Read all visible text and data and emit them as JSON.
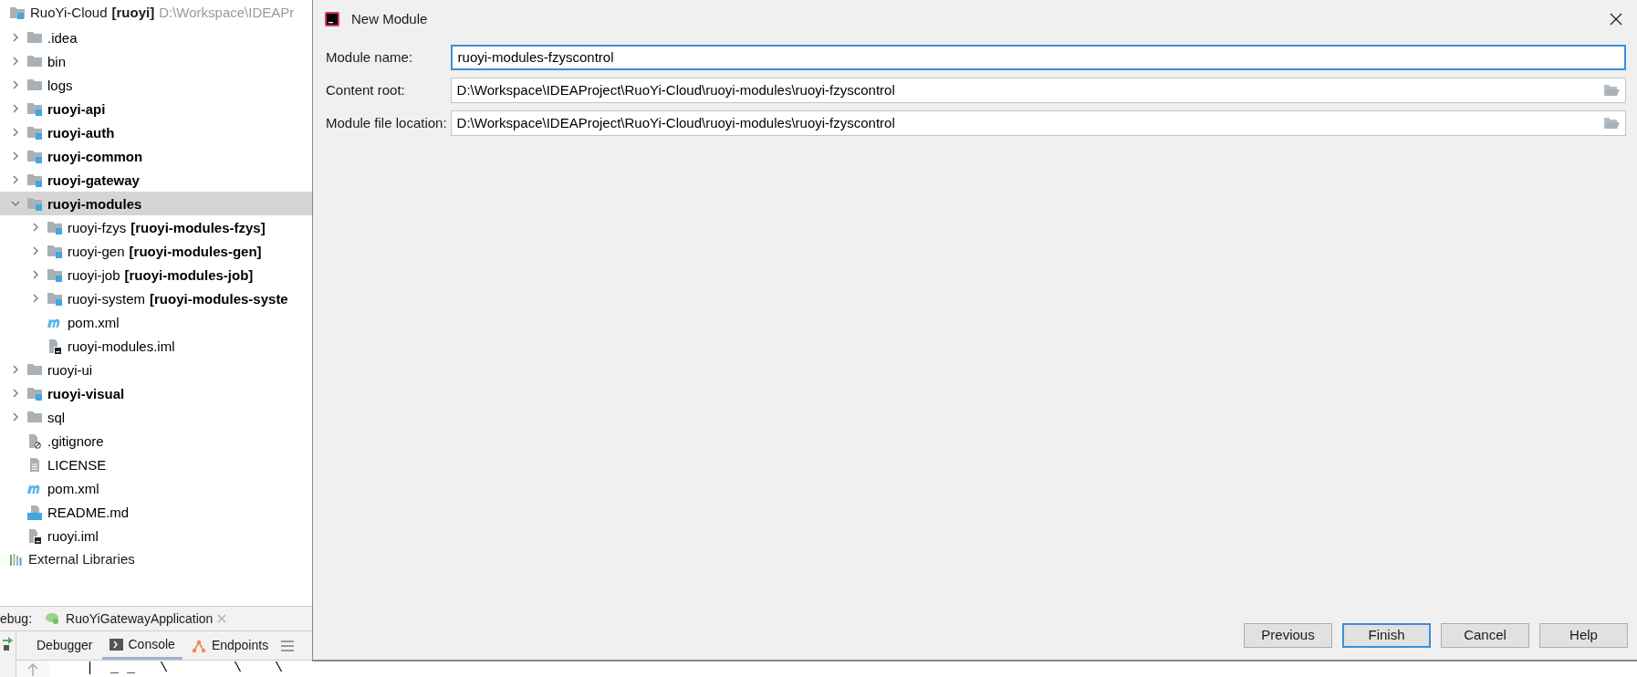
{
  "project_tree": {
    "root": {
      "name": "RuoYi-Cloud",
      "suffix": "[ruoyi]",
      "path": "D:\\Workspace\\IDEAPr"
    },
    "items": [
      {
        "name": ".idea",
        "kind": "folder",
        "bold": false,
        "expanded": false,
        "selected": false
      },
      {
        "name": "bin",
        "kind": "folder",
        "bold": false,
        "expanded": false,
        "selected": false
      },
      {
        "name": "logs",
        "kind": "folder",
        "bold": false,
        "expanded": false,
        "selected": false
      },
      {
        "name": "ruoyi-api",
        "kind": "module",
        "bold": true,
        "expanded": false,
        "selected": false
      },
      {
        "name": "ruoyi-auth",
        "kind": "module",
        "bold": true,
        "expanded": false,
        "selected": false
      },
      {
        "name": "ruoyi-common",
        "kind": "module",
        "bold": true,
        "expanded": false,
        "selected": false
      },
      {
        "name": "ruoyi-gateway",
        "kind": "module",
        "bold": true,
        "expanded": false,
        "selected": false
      },
      {
        "name": "ruoyi-modules",
        "kind": "module",
        "bold": true,
        "expanded": true,
        "selected": true,
        "children": [
          {
            "name": "ruoyi-fzys",
            "suffix": "[ruoyi-modules-fzys]",
            "kind": "module",
            "bold": false,
            "expanded": false,
            "selected": false
          },
          {
            "name": "ruoyi-gen",
            "suffix": "[ruoyi-modules-gen]",
            "kind": "module",
            "bold": false,
            "expanded": false,
            "selected": false
          },
          {
            "name": "ruoyi-job",
            "suffix": "[ruoyi-modules-job]",
            "kind": "module",
            "bold": false,
            "expanded": false,
            "selected": false
          },
          {
            "name": "ruoyi-system",
            "suffix": "[ruoyi-modules-syste",
            "kind": "module",
            "bold": false,
            "expanded": false,
            "selected": false
          },
          {
            "name": "pom.xml",
            "kind": "maven",
            "bold": false,
            "selected": false
          },
          {
            "name": "ruoyi-modules.iml",
            "kind": "iml",
            "bold": false,
            "selected": false
          }
        ]
      },
      {
        "name": "ruoyi-ui",
        "kind": "folder",
        "bold": false,
        "expanded": false,
        "selected": false
      },
      {
        "name": "ruoyi-visual",
        "kind": "module",
        "bold": true,
        "expanded": false,
        "selected": false
      },
      {
        "name": "sql",
        "kind": "folder",
        "bold": false,
        "expanded": false,
        "selected": false
      },
      {
        "name": ".gitignore",
        "kind": "ignore",
        "bold": false,
        "selected": false
      },
      {
        "name": "LICENSE",
        "kind": "text",
        "bold": false,
        "selected": false
      },
      {
        "name": "pom.xml",
        "kind": "maven",
        "bold": false,
        "selected": false
      },
      {
        "name": "README.md",
        "kind": "markdown",
        "bold": false,
        "selected": false
      },
      {
        "name": "ruoyi.iml",
        "kind": "iml",
        "bold": false,
        "selected": false
      }
    ],
    "external": "External Libraries"
  },
  "debug_bar": {
    "label": "ebug:",
    "run_tab": "RuoYiGatewayApplication"
  },
  "console_tabs": [
    {
      "label": "Debugger",
      "selected": false
    },
    {
      "label": "Console",
      "selected": true
    },
    {
      "label": "Endpoints",
      "selected": false
    }
  ],
  "console_lines": [
    "|  _ _   \\        \\    \\"
  ],
  "dialog": {
    "title": "New Module",
    "fields": [
      {
        "label": "Module name:",
        "value": "ruoyi-modules-fzyscontrol",
        "focused": true,
        "browse": false
      },
      {
        "label": "Content root:",
        "value": "D:\\Workspace\\IDEAProject\\RuoYi-Cloud\\ruoyi-modules\\ruoyi-fzyscontrol",
        "focused": false,
        "browse": true
      },
      {
        "label": "Module file location:",
        "value": "D:\\Workspace\\IDEAProject\\RuoYi-Cloud\\ruoyi-modules\\ruoyi-fzyscontrol",
        "focused": false,
        "browse": true
      }
    ],
    "buttons": [
      {
        "label": "Previous",
        "default": false
      },
      {
        "label": "Finish",
        "default": true
      },
      {
        "label": "Cancel",
        "default": false
      },
      {
        "label": "Help",
        "default": false
      }
    ]
  }
}
